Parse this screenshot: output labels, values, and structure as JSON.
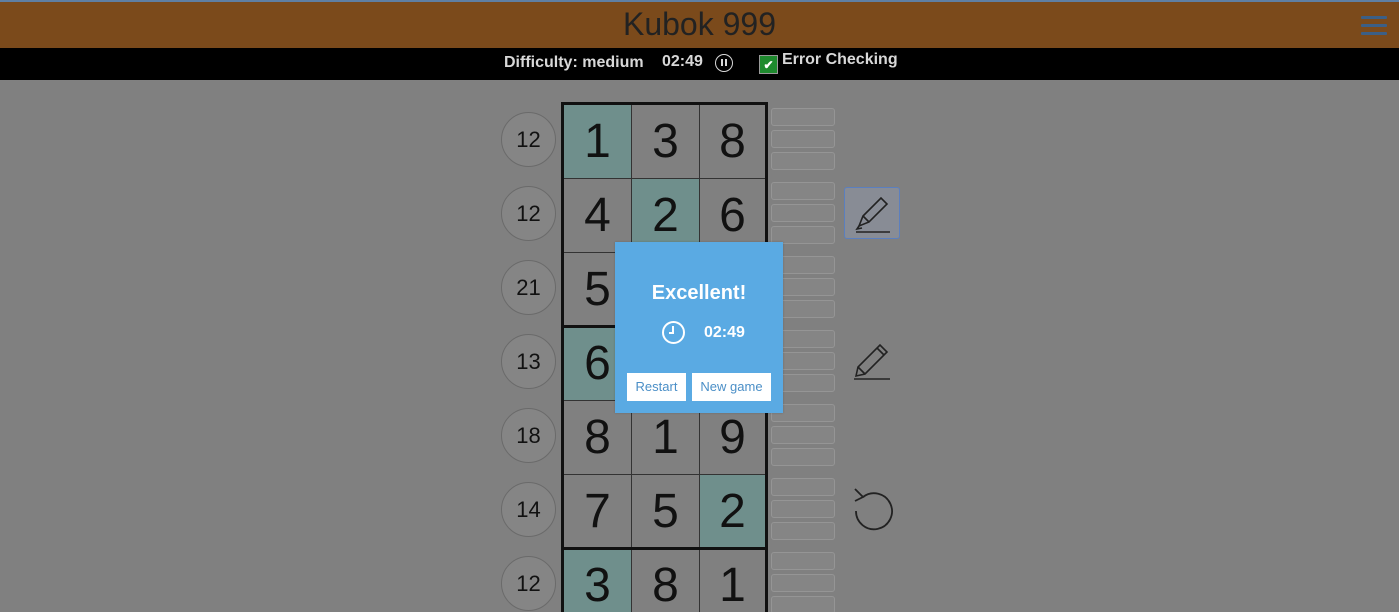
{
  "header": {
    "title": "Kubok 999"
  },
  "infobar": {
    "difficulty": "Difficulty: medium",
    "timer": "02:49",
    "error_checking_label": "Error Checking",
    "error_checking_checked": true,
    "checkmark": "✔"
  },
  "board": {
    "rows": [
      {
        "clue": "12",
        "cells": [
          {
            "value": "1",
            "highlight": true
          },
          {
            "value": "3",
            "highlight": false
          },
          {
            "value": "8",
            "highlight": false
          }
        ]
      },
      {
        "clue": "12",
        "cells": [
          {
            "value": "4",
            "highlight": false
          },
          {
            "value": "2",
            "highlight": true
          },
          {
            "value": "6",
            "highlight": false
          }
        ]
      },
      {
        "clue": "21",
        "cells": [
          {
            "value": "5",
            "highlight": false
          },
          {
            "value": "",
            "highlight": false
          },
          {
            "value": "",
            "highlight": false
          }
        ]
      },
      {
        "clue": "13",
        "cells": [
          {
            "value": "6",
            "highlight": true
          },
          {
            "value": "",
            "highlight": false
          },
          {
            "value": "",
            "highlight": false
          }
        ]
      },
      {
        "clue": "18",
        "cells": [
          {
            "value": "8",
            "highlight": false
          },
          {
            "value": "1",
            "highlight": false
          },
          {
            "value": "9",
            "highlight": false
          }
        ]
      },
      {
        "clue": "14",
        "cells": [
          {
            "value": "7",
            "highlight": false
          },
          {
            "value": "5",
            "highlight": false
          },
          {
            "value": "2",
            "highlight": true
          }
        ]
      },
      {
        "clue": "12",
        "cells": [
          {
            "value": "3",
            "highlight": true
          },
          {
            "value": "8",
            "highlight": false
          },
          {
            "value": "1",
            "highlight": false
          }
        ]
      }
    ]
  },
  "tools": [
    {
      "name": "marker-pen-icon",
      "active": true
    },
    {
      "name": "pencil-icon",
      "active": false
    },
    {
      "name": "undo-icon",
      "active": false
    }
  ],
  "modal": {
    "title": "Excellent!",
    "time": "02:49",
    "restart_label": "Restart",
    "new_game_label": "New game"
  },
  "colors": {
    "header": "#7b4a1b",
    "highlight": "#6f8f8c",
    "modal": "#5aaae3",
    "checkbox": "#1e8a2e"
  }
}
